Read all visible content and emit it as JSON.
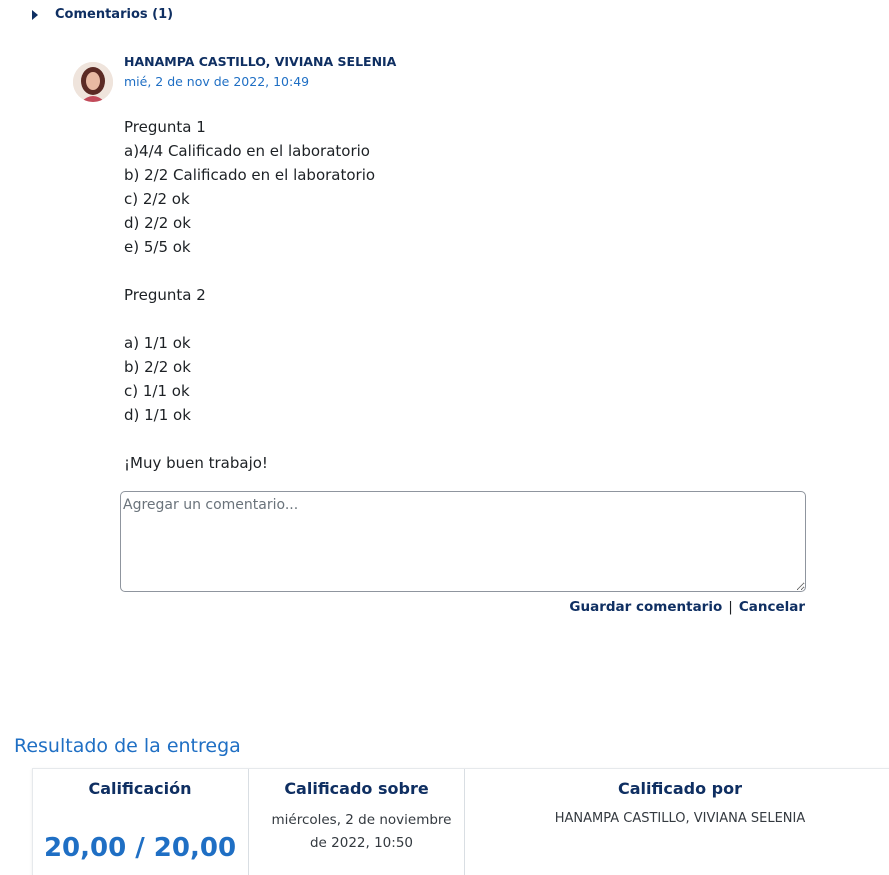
{
  "comments": {
    "toggle_label": "Comentarios (1)",
    "author": "HANAMPA CASTILLO, VIVIANA SELENIA",
    "date": "mié, 2 de nov de 2022, 10:49",
    "body": "Pregunta 1\na)4/4 Calificado en el laboratorio\nb) 2/2 Calificado en el laboratorio\nc) 2/2 ok\nd) 2/2 ok\ne) 5/5 ok\n\nPregunta 2\n\na) 1/1 ok\nb) 2/2 ok\nc) 1/1 ok\nd) 1/1 ok\n\n¡Muy buen trabajo!",
    "input_placeholder": "Agregar un comentario...",
    "input_value": "",
    "save_label": "Guardar comentario",
    "separator": "|",
    "cancel_label": "Cancelar"
  },
  "result": {
    "section_title": "Resultado de la entrega",
    "grade_header": "Calificación",
    "grade_value": "20,00 / 20,00",
    "graded_on_header": "Calificado sobre",
    "graded_on_value": "miércoles, 2 de noviembre de 2022, 10:50",
    "graded_by_header": "Calificado por",
    "graded_by_value": "HANAMPA CASTILLO, VIVIANA SELENIA"
  },
  "colors": {
    "accent": "#1f6fc4",
    "heading": "#0f2f62"
  }
}
